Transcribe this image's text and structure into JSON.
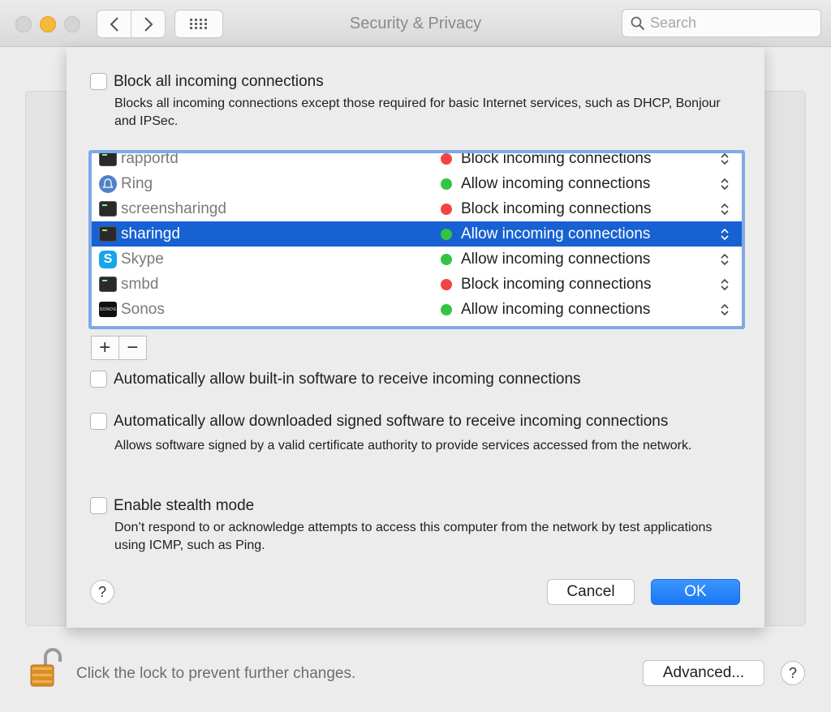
{
  "window": {
    "title": "Security & Privacy",
    "search_placeholder": "Search"
  },
  "sheet": {
    "block_all": {
      "label": "Block all incoming connections",
      "description": "Blocks all incoming connections except those required for basic Internet services, such as DHCP, Bonjour and IPSec."
    },
    "apps": [
      {
        "name": "rapportd",
        "status": "Block incoming connections",
        "state": "block",
        "icon": "terminal-icon"
      },
      {
        "name": "Ring",
        "status": "Allow incoming connections",
        "state": "allow",
        "icon": "ring-bell-icon"
      },
      {
        "name": "screensharingd",
        "status": "Block incoming connections",
        "state": "block",
        "icon": "terminal-icon"
      },
      {
        "name": "sharingd",
        "status": "Allow incoming connections",
        "state": "allow",
        "icon": "terminal-icon",
        "selected": true
      },
      {
        "name": "Skype",
        "status": "Allow incoming connections",
        "state": "allow",
        "icon": "skype-icon"
      },
      {
        "name": "smbd",
        "status": "Block incoming connections",
        "state": "block",
        "icon": "terminal-icon"
      },
      {
        "name": "Sonos",
        "status": "Allow incoming connections",
        "state": "allow",
        "icon": "sonos-icon",
        "icon_text": "SONOS"
      }
    ],
    "add_label": "+",
    "remove_label": "−",
    "auto_builtin": {
      "label": "Automatically allow built-in software to receive incoming connections"
    },
    "auto_signed": {
      "label": "Automatically allow downloaded signed software to receive incoming connections",
      "description": "Allows software signed by a valid certificate authority to provide services accessed from the network."
    },
    "stealth": {
      "label": "Enable stealth mode",
      "description": "Don’t respond to or acknowledge attempts to access this computer from the network by test applications using ICMP, such as Ping."
    },
    "help_label": "?",
    "cancel_label": "Cancel",
    "ok_label": "OK"
  },
  "footer": {
    "lock_text": "Click the lock to prevent further changes.",
    "advanced_label": "Advanced...",
    "help_label": "?"
  },
  "colors": {
    "selection": "#1761d2",
    "allow_dot": "#34c443",
    "block_dot": "#f24545",
    "ok_button": "#1a78f5",
    "list_focus_ring": "#7fa9e6"
  }
}
